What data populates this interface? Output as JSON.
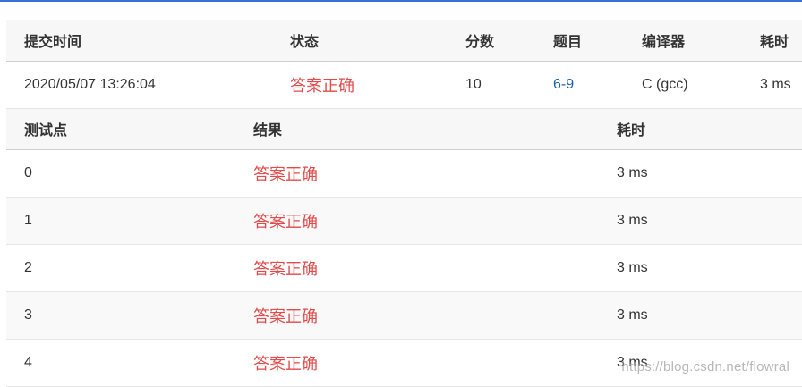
{
  "submission": {
    "headers": [
      "提交时间",
      "状态",
      "分数",
      "题目",
      "编译器",
      "耗时"
    ],
    "row": {
      "time": "2020/05/07 13:26:04",
      "status": "答案正确",
      "score": "10",
      "problem": "6-9",
      "compiler": "C (gcc)",
      "elapsed": "3 ms"
    }
  },
  "test_cases": {
    "headers": [
      "测试点",
      "结果",
      "耗时"
    ],
    "rows": [
      {
        "id": "0",
        "result": "答案正确",
        "time": "3 ms"
      },
      {
        "id": "1",
        "result": "答案正确",
        "time": "3 ms"
      },
      {
        "id": "2",
        "result": "答案正确",
        "time": "3 ms"
      },
      {
        "id": "3",
        "result": "答案正确",
        "time": "3 ms"
      },
      {
        "id": "4",
        "result": "答案正确",
        "time": "3 ms"
      }
    ]
  },
  "watermark": "https://blog.csdn.net/flowral",
  "colors": {
    "accepted": "#e04b4b",
    "link": "#1e5fa8",
    "top_rule": "#3a6fd8"
  }
}
